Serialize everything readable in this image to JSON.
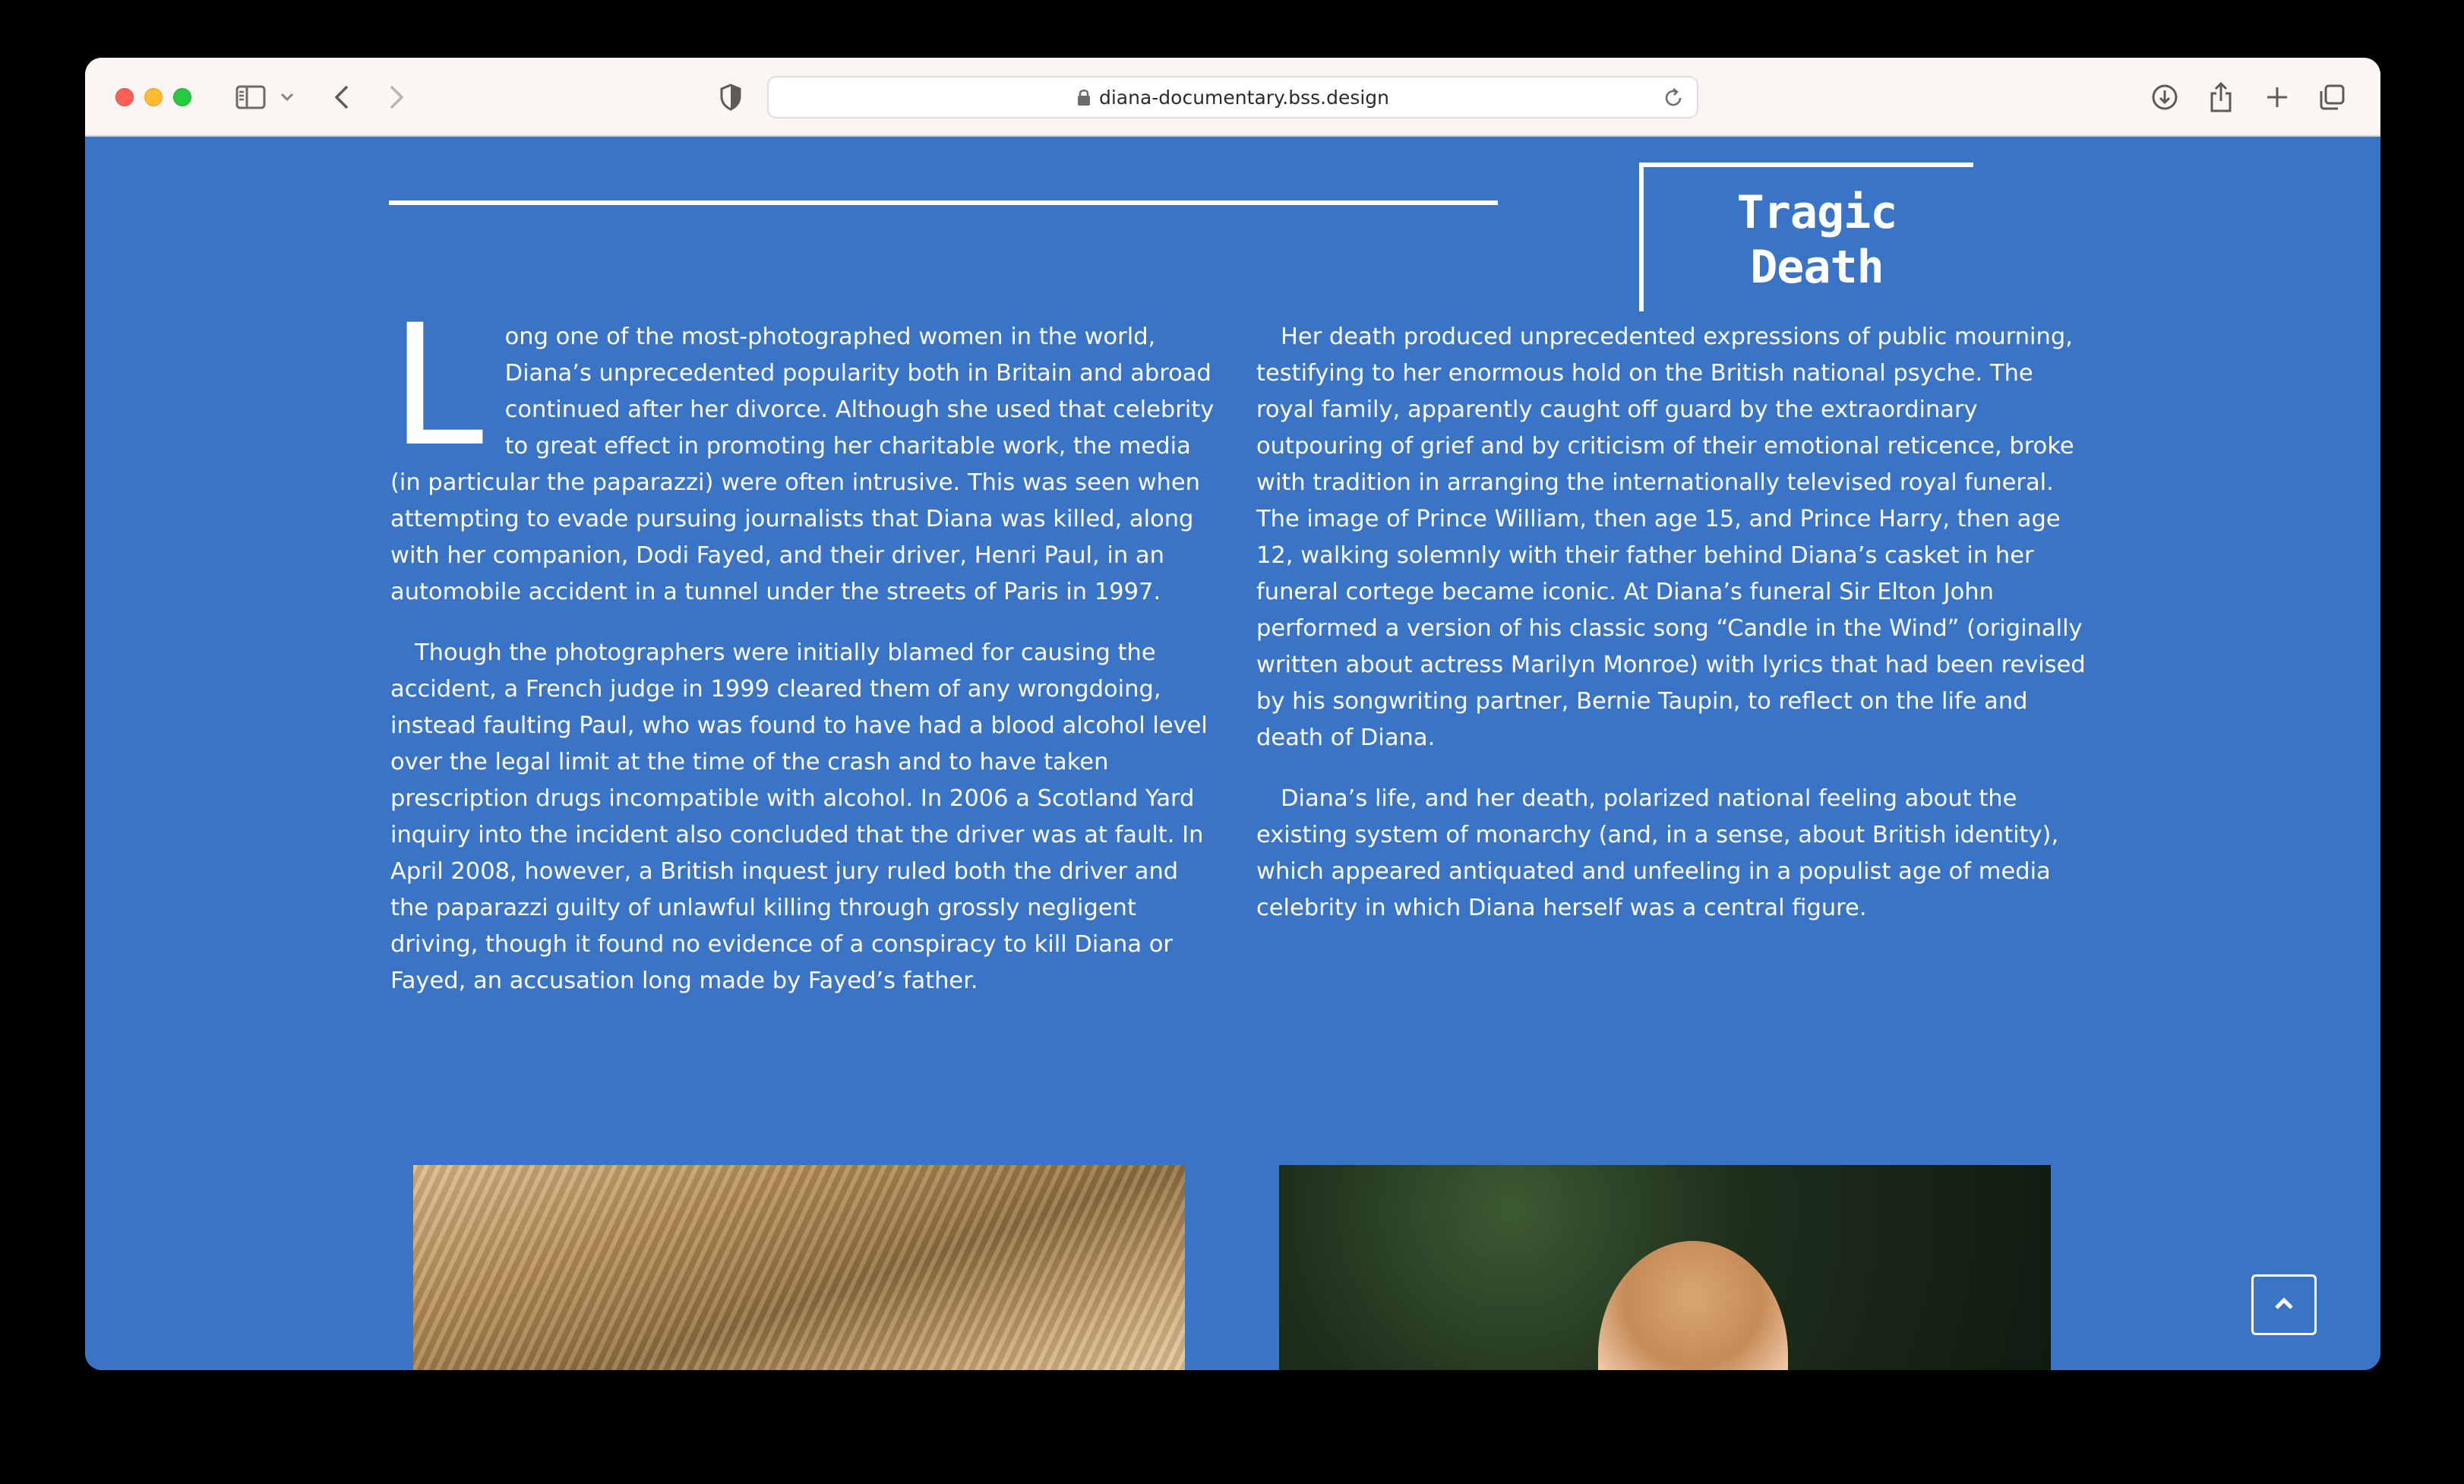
{
  "browser": {
    "url": "diana-documentary.bss.design",
    "icons": [
      "sidebar-icon",
      "chevron-down-icon",
      "back-icon",
      "forward-icon",
      "shield-icon",
      "lock-icon",
      "reload-icon",
      "download-icon",
      "share-icon",
      "plus-icon",
      "tabs-icon"
    ]
  },
  "section": {
    "title_line1": "Tragic",
    "title_line2": "Death"
  },
  "left_column": {
    "dropcap": "L",
    "p1": "ong one of the most-photographed women in the world, Diana’s unprecedented popularity both in Britain and abroad continued after her divorce. Although she used that celebrity to great effect in promoting her charitable work, the media (in particular the paparazzi) were often intrusive. This was seen when attempting to evade pursuing journalists that Diana was killed, along with her companion, Dodi Fayed, and their driver, Henri Paul, in an automobile accident in a tunnel under the streets of Paris in 1997.",
    "p2": "Though the photographers were initially blamed for causing the accident, a French judge in 1999 cleared them of any wrongdoing, instead faulting Paul, who was found to have had a blood alcohol level over the legal limit at the time of the crash and to have taken prescription drugs incompatible with alcohol. In 2006 a Scotland Yard inquiry into the incident also concluded that the driver was at fault. In April 2008, however, a British inquest jury ruled both the driver and the paparazzi guilty of unlawful killing through grossly negligent driving, though it found no evidence of a conspiracy to kill Diana or Fayed, an accusation long made by Fayed’s father."
  },
  "right_column": {
    "p1": "Her death produced unprecedented expressions of public mourning, testifying to her enormous hold on the British national psyche. The royal family, apparently caught off guard by the extraordinary outpouring of grief and by criticism of their emotional reticence, broke with tradition in arranging the internationally televised royal funeral. The image of Prince William, then age 15, and Prince Harry, then age 12, walking solemnly with their father behind Diana’s casket in her funeral cortege became iconic. At Diana’s funeral Sir Elton John performed a version of his classic song “Candle in the Wind” (originally written about actress Marilyn Monroe) with lyrics that had been revised by his songwriting partner, Bernie Taupin, to reflect on the life and death of Diana.",
    "p2": "Diana’s life, and her death, polarized national feeling about the existing system of monarchy (and, in a sense, about British identity), which appeared antiquated and unfeeling in a populist age of media celebrity in which Diana herself was a central figure."
  },
  "colors": {
    "page_background": "#3a74c7",
    "text": "#ffffff",
    "toolbar": "#fbf6f3"
  }
}
